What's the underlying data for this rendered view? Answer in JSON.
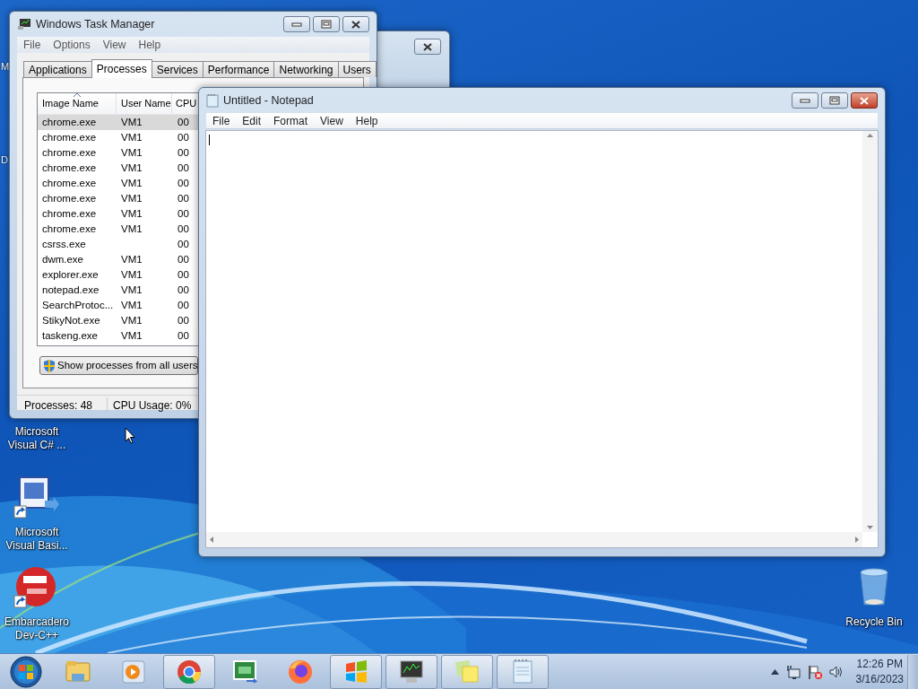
{
  "desktop_icons": [
    {
      "label": "M",
      "kind": "covered"
    },
    {
      "label": "D",
      "kind": "covered"
    },
    {
      "label": "Microsoft Visual C# ...",
      "kind": "covered"
    },
    {
      "label": "Microsoft Visual Basi...",
      "kind": "vb"
    },
    {
      "label": "Embarcadero Dev-C++",
      "kind": "devcpp"
    },
    {
      "label": "Recycle Bin",
      "kind": "bin"
    }
  ],
  "task_manager": {
    "title": "Windows Task Manager",
    "menu": [
      "File",
      "Options",
      "View",
      "Help"
    ],
    "tabs": [
      {
        "label": "Applications",
        "selected": false
      },
      {
        "label": "Processes",
        "selected": true
      },
      {
        "label": "Services",
        "selected": false
      },
      {
        "label": "Performance",
        "selected": false
      },
      {
        "label": "Networking",
        "selected": false
      },
      {
        "label": "Users",
        "selected": false
      }
    ],
    "columns": [
      {
        "label": "Image Name",
        "sorted": true
      },
      {
        "label": "User Name",
        "sorted": false
      },
      {
        "label": "CPU",
        "sorted": false
      }
    ],
    "rows": [
      {
        "cells": [
          "chrome.exe",
          "VM1",
          "00"
        ],
        "selected": true
      },
      {
        "cells": [
          "chrome.exe",
          "VM1",
          "00"
        ],
        "selected": false
      },
      {
        "cells": [
          "chrome.exe",
          "VM1",
          "00"
        ],
        "selected": false
      },
      {
        "cells": [
          "chrome.exe",
          "VM1",
          "00"
        ],
        "selected": false
      },
      {
        "cells": [
          "chrome.exe",
          "VM1",
          "00"
        ],
        "selected": false
      },
      {
        "cells": [
          "chrome.exe",
          "VM1",
          "00"
        ],
        "selected": false
      },
      {
        "cells": [
          "chrome.exe",
          "VM1",
          "00"
        ],
        "selected": false
      },
      {
        "cells": [
          "chrome.exe",
          "VM1",
          "00"
        ],
        "selected": false
      },
      {
        "cells": [
          "csrss.exe",
          "",
          "00"
        ],
        "selected": false
      },
      {
        "cells": [
          "dwm.exe",
          "VM1",
          "00"
        ],
        "selected": false
      },
      {
        "cells": [
          "explorer.exe",
          "VM1",
          "00"
        ],
        "selected": false
      },
      {
        "cells": [
          "notepad.exe",
          "VM1",
          "00"
        ],
        "selected": false
      },
      {
        "cells": [
          "SearchProtoc...",
          "VM1",
          "00"
        ],
        "selected": false
      },
      {
        "cells": [
          "StikyNot.exe",
          "VM1",
          "00"
        ],
        "selected": false
      },
      {
        "cells": [
          "taskeng.exe",
          "VM1",
          "00"
        ],
        "selected": false
      }
    ],
    "button": "Show processes from all users",
    "status": [
      "Processes: 48",
      "CPU Usage: 0%"
    ]
  },
  "notepad": {
    "title": "Untitled - Notepad",
    "menu": [
      "File",
      "Edit",
      "Format",
      "View",
      "Help"
    ]
  },
  "taskbar": {
    "items": [
      {
        "kind": "folder",
        "running": false
      },
      {
        "kind": "media",
        "running": false
      },
      {
        "kind": "browser",
        "running": true
      },
      {
        "kind": "csharp",
        "running": false
      },
      {
        "kind": "fox",
        "running": false
      },
      {
        "kind": "flag",
        "running": true
      },
      {
        "kind": "monitor",
        "running": true
      },
      {
        "kind": "notes",
        "running": true
      },
      {
        "kind": "notepad",
        "running": true
      }
    ],
    "clock": {
      "time": "12:26 PM",
      "date": "3/16/2023"
    }
  }
}
